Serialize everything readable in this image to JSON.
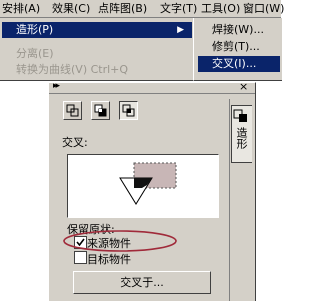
{
  "menubar": {
    "items": [
      {
        "label": "安排(A)"
      },
      {
        "label": "效果(C)"
      },
      {
        "label": "点阵图(B)"
      },
      {
        "label": "文字(T)"
      },
      {
        "label": "工具(O)"
      },
      {
        "label": "窗口(W)"
      }
    ]
  },
  "dropdown": {
    "shaping_label": "造形(P)",
    "shaping_arrow": "▶",
    "disabled_item_1": "分离(E)",
    "disabled_item_2": "转换为曲线(V)    Ctrl+Q"
  },
  "submenu": {
    "items": [
      {
        "label": "焊接(W)..."
      },
      {
        "label": "修剪(T)..."
      },
      {
        "label": "交叉(I)..."
      }
    ]
  },
  "panel": {
    "collapse_glyph": "▸▸",
    "close_glyph": "×",
    "tab_label": "造形",
    "section_title": "交叉:",
    "keep_label": "保留原状:",
    "checkbox_source": {
      "label": "来源物件",
      "checked": true
    },
    "checkbox_target": {
      "label": "目标物件",
      "checked": false
    },
    "intersect_button": "交叉于...",
    "annotation_color": "#a02a3a"
  }
}
